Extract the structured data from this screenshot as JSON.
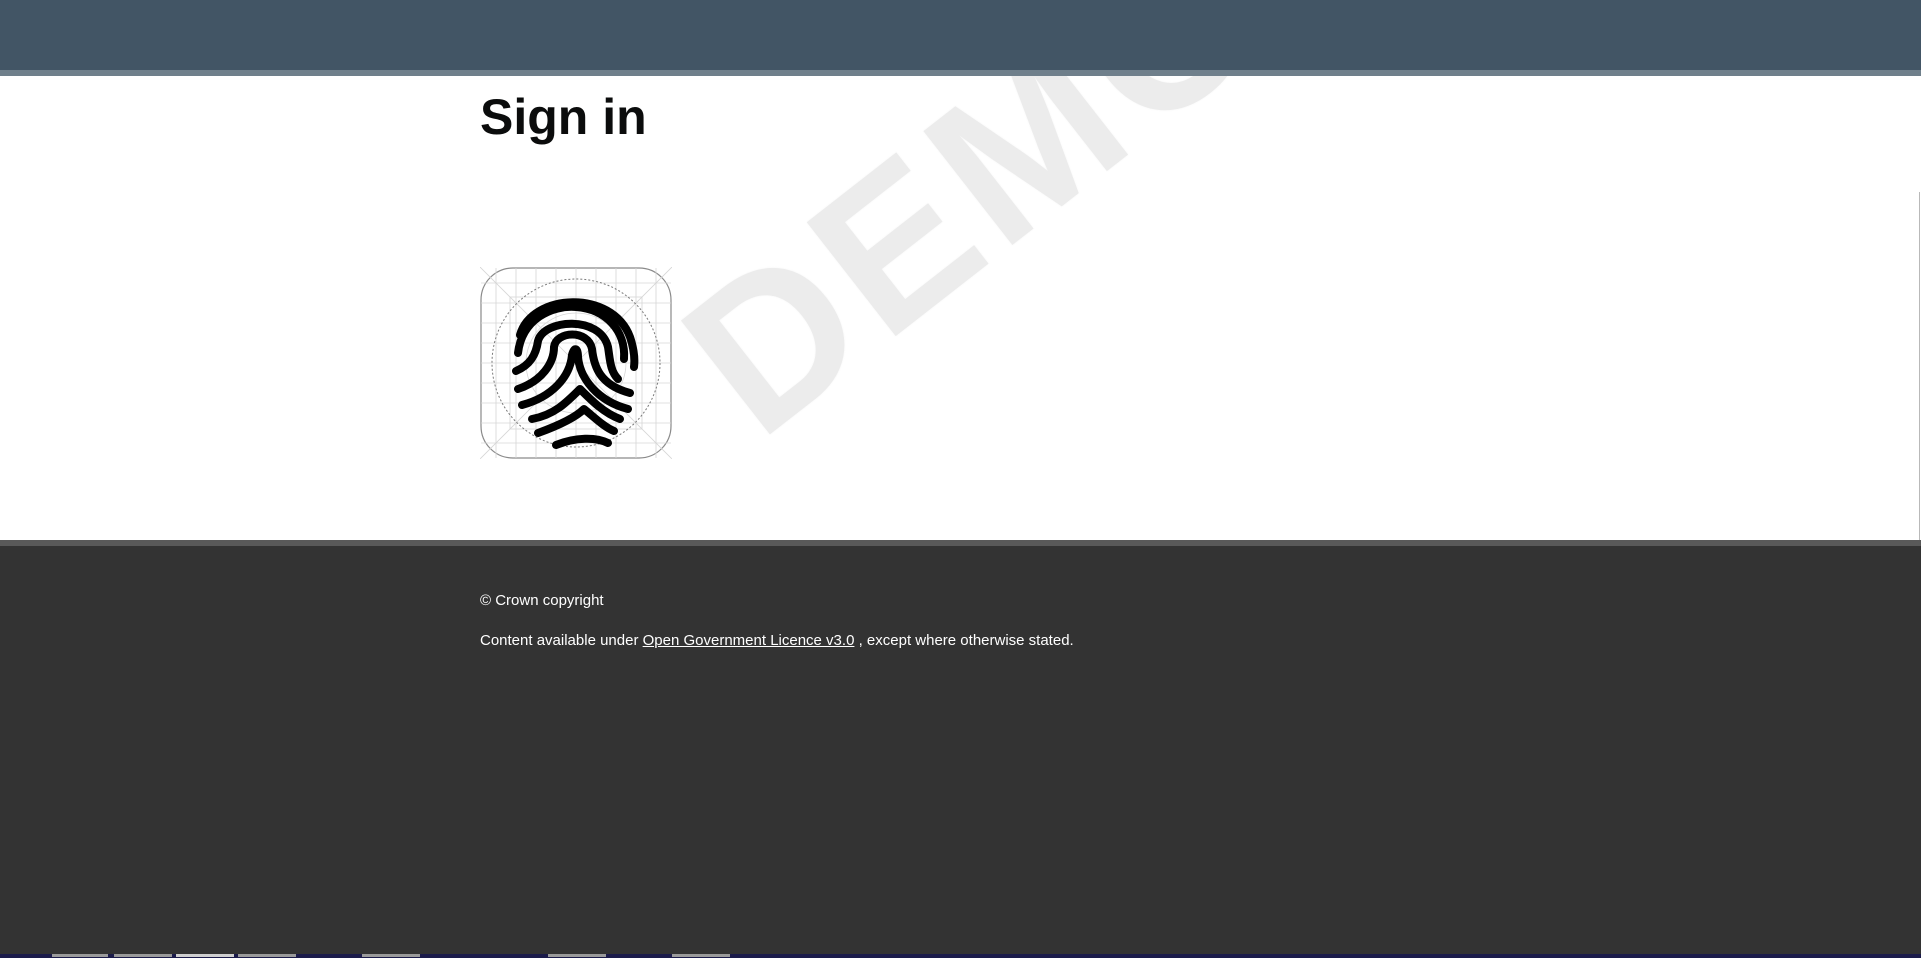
{
  "header": {
    "background": "#425565",
    "accent_rule": "#6f7f8b"
  },
  "main": {
    "title": "Sign in",
    "watermark": "DEMO",
    "fingerprint": {
      "icon": "fingerprint-icon"
    }
  },
  "footer": {
    "background": "#333333",
    "copyright": "© Crown copyright",
    "licence_prefix": "Content available under ",
    "licence_link": "Open Government Licence v3.0",
    "licence_suffix": " , except where otherwise stated."
  }
}
